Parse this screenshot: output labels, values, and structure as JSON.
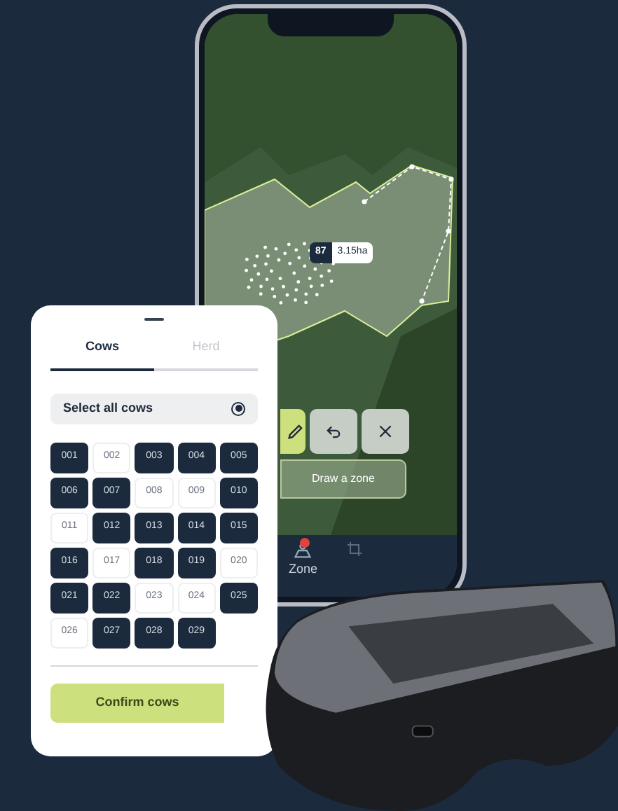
{
  "map": {
    "zone_count": "87",
    "zone_area": "3.15ha"
  },
  "tools": [
    {
      "kind": "pencil",
      "selected": true
    },
    {
      "kind": "undo",
      "selected": false
    },
    {
      "kind": "close",
      "selected": false
    }
  ],
  "draw_button": "Draw a zone",
  "nav": [
    {
      "label": "Zone",
      "badge": true
    }
  ],
  "panel": {
    "tabs": [
      {
        "label": "Cows",
        "selected": true
      },
      {
        "label": "Herd",
        "selected": false
      }
    ],
    "select_all": {
      "label": "Select all cows",
      "checked": true
    },
    "cows": [
      {
        "id": "001",
        "selected": true
      },
      {
        "id": "002",
        "selected": false
      },
      {
        "id": "003",
        "selected": true
      },
      {
        "id": "004",
        "selected": true
      },
      {
        "id": "005",
        "selected": true
      },
      {
        "id": "006",
        "selected": true
      },
      {
        "id": "007",
        "selected": true
      },
      {
        "id": "008",
        "selected": false
      },
      {
        "id": "009",
        "selected": false
      },
      {
        "id": "010",
        "selected": true
      },
      {
        "id": "011",
        "selected": false
      },
      {
        "id": "012",
        "selected": true
      },
      {
        "id": "013",
        "selected": true
      },
      {
        "id": "014",
        "selected": true
      },
      {
        "id": "015",
        "selected": true
      },
      {
        "id": "016",
        "selected": true
      },
      {
        "id": "017",
        "selected": false
      },
      {
        "id": "018",
        "selected": true
      },
      {
        "id": "019",
        "selected": true
      },
      {
        "id": "020",
        "selected": false
      },
      {
        "id": "021",
        "selected": true
      },
      {
        "id": "022",
        "selected": true
      },
      {
        "id": "023",
        "selected": false
      },
      {
        "id": "024",
        "selected": false
      },
      {
        "id": "025",
        "selected": true
      },
      {
        "id": "026",
        "selected": false
      },
      {
        "id": "027",
        "selected": true
      },
      {
        "id": "028",
        "selected": true
      },
      {
        "id": "029",
        "selected": true
      }
    ],
    "confirm_button": "Confirm cows"
  }
}
